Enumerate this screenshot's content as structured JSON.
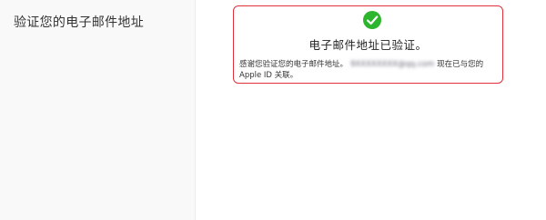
{
  "sidebar": {
    "title": "验证您的电子邮件地址"
  },
  "card": {
    "check_icon": "checkmark-circle-icon",
    "success_color": "#2db52d",
    "border_color": "#e0303a",
    "title": "电子邮件地址已验证。",
    "message_before": "感谢您验证您的电子邮件地址。",
    "email_redacted": "9XXXXXXXX@qq.com",
    "message_after_1": "现在已与您的",
    "message_after_2": "Apple ID 关联。"
  }
}
